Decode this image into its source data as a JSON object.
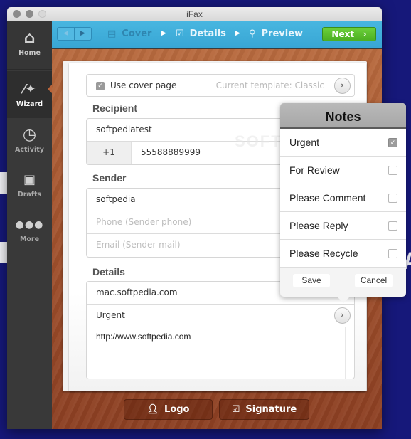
{
  "window": {
    "title": "iFax"
  },
  "sidebar": {
    "items": [
      {
        "label": "Home",
        "icon": "home-icon",
        "active": false
      },
      {
        "label": "Wizard",
        "icon": "magic-wand-icon",
        "active": true
      },
      {
        "label": "Activity",
        "icon": "clock-icon",
        "active": false
      },
      {
        "label": "Drafts",
        "icon": "paperclip-icon",
        "active": false
      },
      {
        "label": "More",
        "icon": "more-dots-icon",
        "active": false
      }
    ]
  },
  "toolbar": {
    "steps": [
      {
        "label": "Cover",
        "icon": "document-icon",
        "current": true
      },
      {
        "label": "Details",
        "icon": "edit-icon",
        "current": false
      },
      {
        "label": "Preview",
        "icon": "search-icon",
        "current": false
      }
    ],
    "next_label": "Next",
    "next_glyph": "›"
  },
  "cover": {
    "use_cover_label": "Use cover page",
    "use_cover_checked": true,
    "template_label": "Current template: Classic"
  },
  "recipient": {
    "heading": "Recipient",
    "name": "softpediatest",
    "country_code": "+1",
    "fax_number": "55588889999"
  },
  "sender": {
    "heading": "Sender",
    "name": "softpedia",
    "phone_placeholder": "Phone (Sender phone)",
    "email_placeholder": "Email (Sender mail)"
  },
  "details": {
    "heading": "Details",
    "subject": "mac.softpedia.com",
    "notes_value": "Urgent",
    "message": "http://www.softpedia.com"
  },
  "notes_popover": {
    "title": "Notes",
    "options": [
      {
        "label": "Urgent",
        "checked": true
      },
      {
        "label": "For Review",
        "checked": false
      },
      {
        "label": "Please Comment",
        "checked": false
      },
      {
        "label": "Please Reply",
        "checked": false
      },
      {
        "label": "Please Recycle",
        "checked": false
      }
    ],
    "save_label": "Save",
    "cancel_label": "Cancel"
  },
  "bottom_buttons": {
    "logo_label": "Logo",
    "signature_label": "Signature"
  },
  "watermark": "SOFTPEDIA",
  "colors": {
    "toolbar": "#3cacd9",
    "next_button": "#5cc02e",
    "sidebar": "#393939",
    "wood": "#a65630",
    "background": "#16187a"
  }
}
